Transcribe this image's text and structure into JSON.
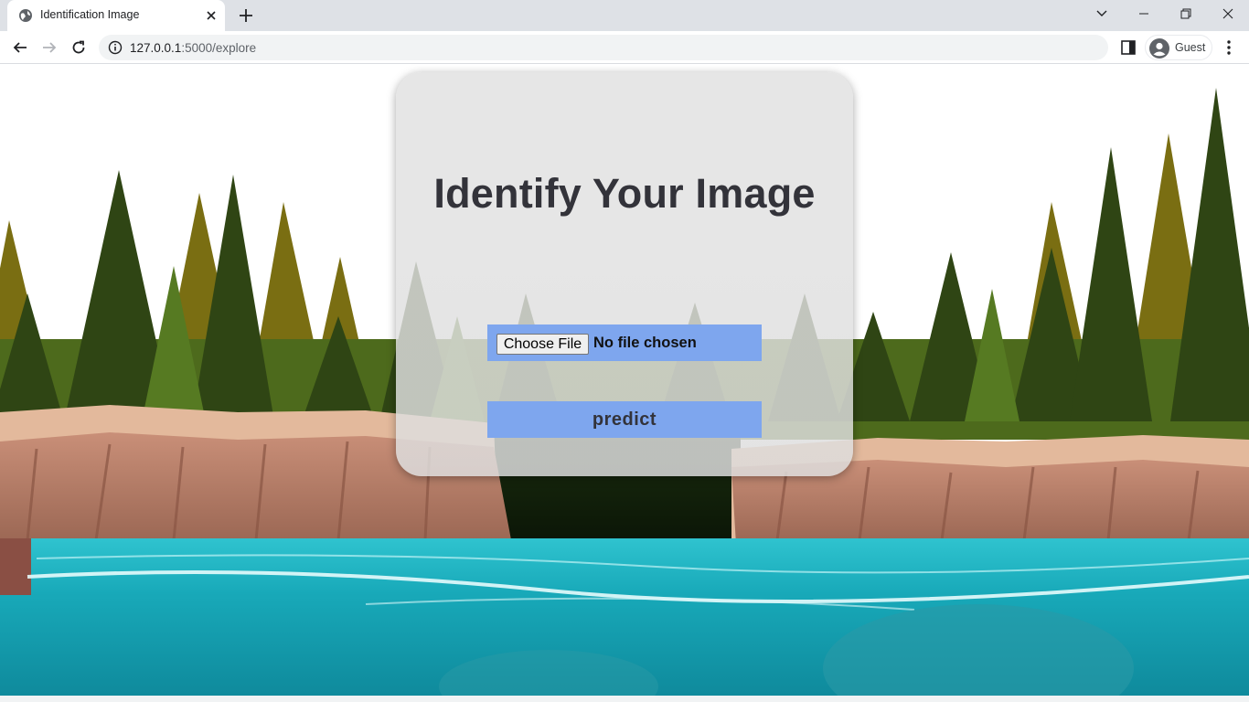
{
  "browser": {
    "tab": {
      "title": "Identification Image",
      "favicon": "globe-icon"
    },
    "url": {
      "host": "127.0.0.1",
      "path": ":5000/explore"
    },
    "profile": {
      "label": "Guest"
    }
  },
  "page": {
    "title": "Identify Your Image",
    "file_input": {
      "button_label": "Choose File",
      "status": "No file chosen"
    },
    "predict_label": "predict"
  },
  "colors": {
    "button_bg": "#7ea6ee",
    "card_bg": "#e1e1e1",
    "title_text": "#33333a"
  }
}
